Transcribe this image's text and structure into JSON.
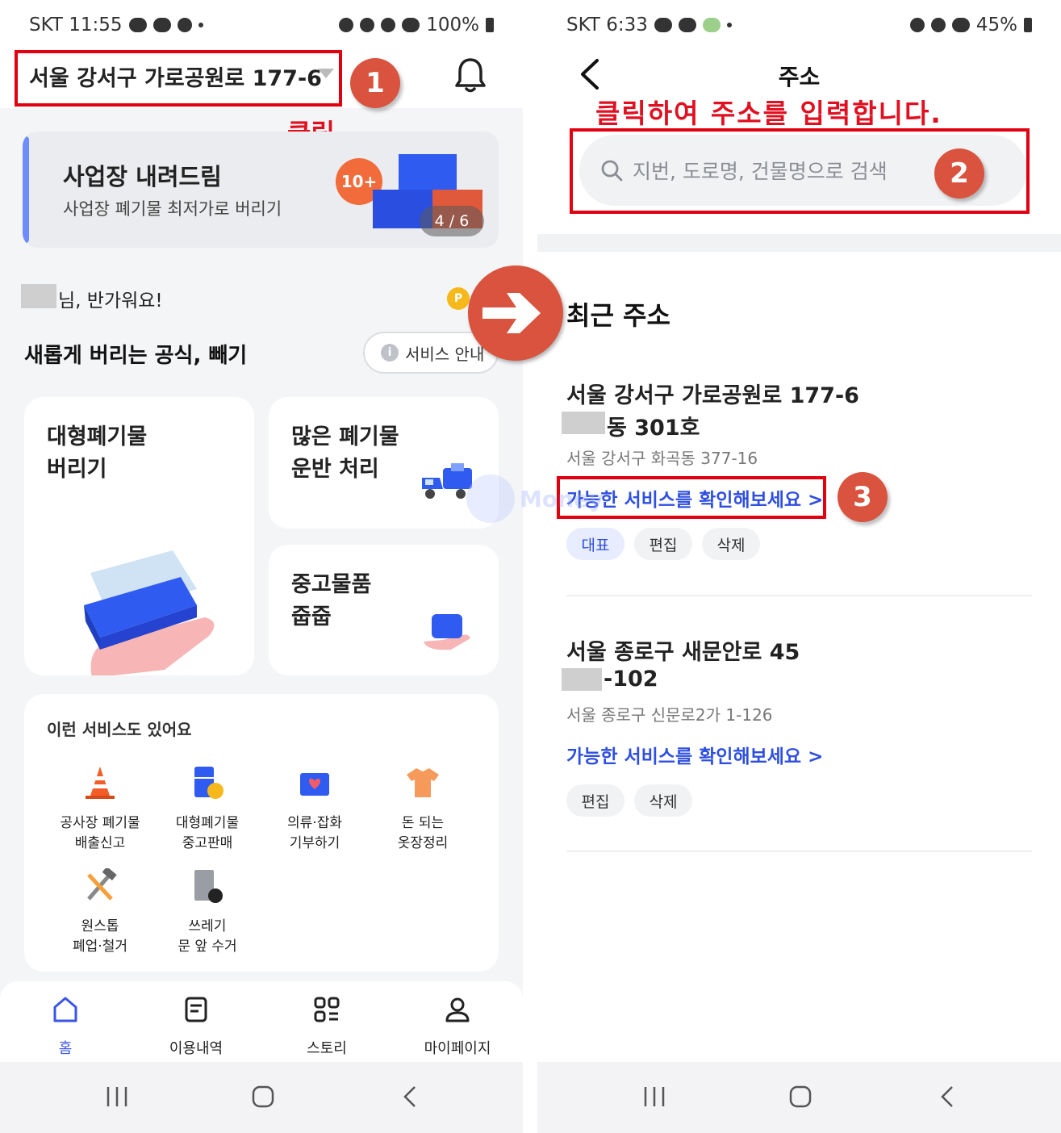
{
  "left": {
    "status": {
      "carrier_time": "SKT 11:55",
      "battery": "100%"
    },
    "header": {
      "address": "서울 강서구 가로공원로 177-6"
    },
    "annotations": {
      "click_note": "클릭",
      "step1": "1"
    },
    "banner": {
      "title": "사업장 내려드림",
      "subtitle": "사업장 폐기물 최저가로 버리기",
      "badge": "10+",
      "counter": "4 / 6"
    },
    "greeting": "님, 반가워요!",
    "points_icon": "P",
    "section_title": "새롭게 버리는 공식, 빼기",
    "service_guide_button": "서비스 안내",
    "cards": {
      "large_waste": "대형폐기물\n버리기",
      "much_waste": "많은 폐기물\n운반 처리",
      "used_goods": "중고물품\n줍줍"
    },
    "more_services": {
      "title": "이런 서비스도 있어요",
      "items": [
        {
          "line1": "공사장 폐기물",
          "line2": "배출신고",
          "icon": "traffic-cone-icon"
        },
        {
          "line1": "대형폐기물",
          "line2": "중고판매",
          "icon": "fridge-coin-icon"
        },
        {
          "line1": "의류·잡화",
          "line2": "기부하기",
          "icon": "donation-box-icon"
        },
        {
          "line1": "돈 되는",
          "line2": "옷장정리",
          "icon": "shirt-icon"
        },
        {
          "line1": "원스톱",
          "line2": "폐업·철거",
          "icon": "tools-icon"
        },
        {
          "line1": "쓰레기",
          "line2": "문 앞 수거",
          "icon": "door-bag-icon"
        }
      ]
    },
    "tabs": [
      "홈",
      "이용내역",
      "스토리",
      "마이페이지"
    ]
  },
  "right": {
    "status": {
      "carrier_time": "SKT 6:33",
      "battery": "45%"
    },
    "title": "주소",
    "annotations": {
      "note": "클릭하여 주소를 입력합니다.",
      "step2": "2",
      "step3": "3"
    },
    "search_placeholder": "지번, 도로명, 건물명으로 검색",
    "recent_title": "최근 주소",
    "addresses": [
      {
        "main": "서울 강서구 가로공원로 177-6",
        "detail": "동 301호",
        "jibun": "서울 강서구 화곡동 377-16",
        "link": "가능한 서비스를 확인해보세요 >",
        "chips": [
          "대표",
          "편집",
          "삭제"
        ]
      },
      {
        "main": "서울 종로구 새문안로 45",
        "detail": "-102",
        "jibun": "서울 종로구 신문로2가 1-126",
        "link": "가능한 서비스를 확인해보세요 >",
        "chips": [
          "편집",
          "삭제"
        ]
      }
    ]
  },
  "watermark": "Money",
  "colors": {
    "accent_blue": "#3a55e6",
    "link_blue": "#2f4fe0",
    "annotation_red": "#e00010",
    "step_badge": "#d9533e"
  }
}
